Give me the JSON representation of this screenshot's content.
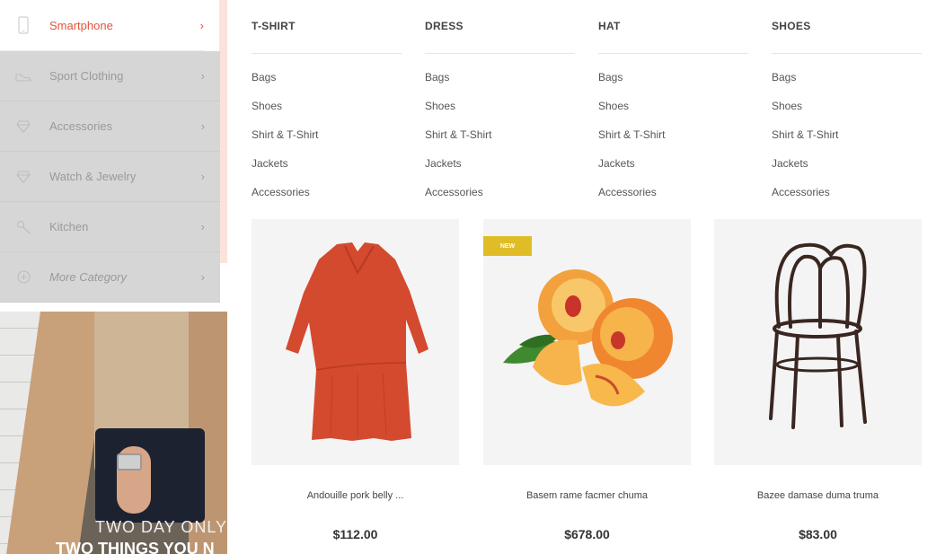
{
  "sidebar": {
    "items": [
      {
        "label": "Smartphone",
        "icon": "smartphone-icon",
        "active": true
      },
      {
        "label": "Sport Clothing",
        "icon": "sneaker-icon"
      },
      {
        "label": "Accessories",
        "icon": "diamond-icon"
      },
      {
        "label": "Watch & Jewelry",
        "icon": "diamond-icon"
      },
      {
        "label": "Kitchen",
        "icon": "spatula-icon"
      },
      {
        "label": "More Category",
        "icon": "plus-circle-icon"
      }
    ],
    "chevron": "›",
    "accent_color": "#e2543c"
  },
  "promo": {
    "line1": "TWO DAY ONLY",
    "line2": "TWO THINGS YOU N"
  },
  "menu": {
    "columns": [
      {
        "title": "T-SHIRT",
        "links": [
          "Bags",
          "Shoes",
          "Shirt & T-Shirt",
          "Jackets",
          "Accessories"
        ]
      },
      {
        "title": "DRESS",
        "links": [
          "Bags",
          "Shoes",
          "Shirt & T-Shirt",
          "Jackets",
          "Accessories"
        ]
      },
      {
        "title": "HAT",
        "links": [
          "Bags",
          "Shoes",
          "Shirt & T-Shirt",
          "Jackets",
          "Accessories"
        ]
      },
      {
        "title": "SHOES",
        "links": [
          "Bags",
          "Shoes",
          "Shirt & T-Shirt",
          "Jackets",
          "Accessories"
        ]
      }
    ]
  },
  "products": [
    {
      "name": "Andouille pork belly ...",
      "price": "$112.00",
      "image": "red-dress"
    },
    {
      "name": "Basem rame facmer chuma",
      "price": "$678.00",
      "image": "peaches",
      "badge": "NEW"
    },
    {
      "name": "Bazee damase duma truma",
      "price": "$83.00",
      "image": "bentwood-chair"
    }
  ]
}
